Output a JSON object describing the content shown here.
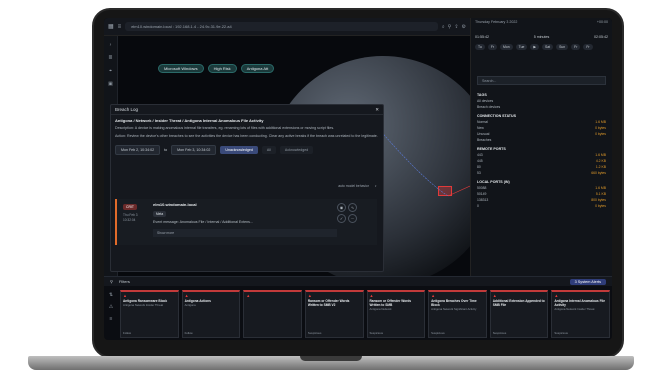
{
  "browser": {
    "url": "elm10.windomain.local : 192.168.1.4 - 24.9c.31.9e.22.a4"
  },
  "map": {
    "chips": [
      "Microsoft Windows",
      "High Risk",
      "Antigona Att"
    ]
  },
  "breach_log": {
    "title": "Breach Log",
    "headline": "Antigona / Network / Insider Threat / Antigona Internal Anomalous File Activity",
    "description": "Description: A device is making anomalous internal file transfers, eg. renaming lots of files with additional extensions or moving script files.",
    "action": "Action: Review the device's other breaches to see the activities the device has been conducting. Clear any active breaks if the breach was unrelated to the legitimate.",
    "date_from": "Mon Feb 2, 10:34:02",
    "date_sep": "to",
    "date_to": "Mon Feb 3, 10:34:02",
    "seg_unack": "Unacknowledged",
    "seg_all": "All",
    "seg_ack": "Acknowledged",
    "auto_label": "auto model behavior",
    "entry": {
      "severity": "CRIT",
      "date": "Thu Feb 3",
      "time": "10:32:04",
      "host": "elm10.windomain.local",
      "tag": "Meta",
      "message": "Event message: Anomalous File / Internal / Additional Extens...",
      "show_more": "Show more"
    }
  },
  "right_panel": {
    "date": "Thursday February 3 2022",
    "time_start": "01:55:42",
    "time_mid": "5 minutes",
    "time_end": "02:05:42",
    "speed": "+00:00",
    "play_controls": [
      "Tu",
      "Fr",
      "Mon",
      "Tue",
      "▶",
      "Sat",
      "Sun",
      "Fr",
      "Fr"
    ],
    "search_placeholder": "Search...",
    "sections": [
      {
        "title": "TAGS",
        "rows": [
          [
            "All devices",
            ""
          ],
          [
            "Breach devices",
            ""
          ]
        ]
      },
      {
        "title": "CONNECTION STATUS",
        "rows": [
          [
            "Normal",
            "1.6 MB"
          ],
          [
            "New",
            "0 bytes"
          ],
          [
            "Unusual",
            "0 bytes"
          ],
          [
            "Breaches",
            ""
          ]
        ]
      },
      {
        "title": "REMOTE PORTS",
        "rows": [
          [
            "443",
            "1.6 MB"
          ],
          [
            "445",
            "4.2 KB"
          ],
          [
            "80",
            "1.2 KB"
          ],
          [
            "53",
            "660 bytes"
          ]
        ]
      },
      {
        "title": "LOCAL PORTS (IN)",
        "rows": [
          [
            "50088",
            "1.6 MB"
          ],
          [
            "50149",
            "5.1 KB"
          ],
          [
            "138313",
            "800 bytes"
          ],
          [
            "0",
            "0 bytes"
          ]
        ]
      }
    ]
  },
  "filters": {
    "label": "Filters",
    "alerts": "3 System Alerts"
  },
  "cards": [
    {
      "title": "Antigona Ransomware Block",
      "sub": "Antigona Network Insider Threat",
      "foot": "Follow"
    },
    {
      "title": "Antigona Actions",
      "sub": "Antigona",
      "foot": "Follow"
    },
    {
      "title": "",
      "sub": "",
      "foot": ""
    },
    {
      "title": "Ransom or Offender Words Written to SMB V2",
      "sub": "",
      "foot": "Suspicious"
    },
    {
      "title": "Ransom or Offender Words Written to SMB",
      "sub": "Antigona Network",
      "foot": "Suspicious"
    },
    {
      "title": "Antigona Breaches Over Time Block",
      "sub": "Antigona Network Significant Activity",
      "foot": "Suspicious"
    },
    {
      "title": "Additional Extension Appended to SMB File",
      "sub": "",
      "foot": "Suspicious"
    },
    {
      "title": "Antigona Internal Anomalous File Activity",
      "sub": "Antigona Network Insider Threat",
      "foot": "Suspicious"
    }
  ]
}
